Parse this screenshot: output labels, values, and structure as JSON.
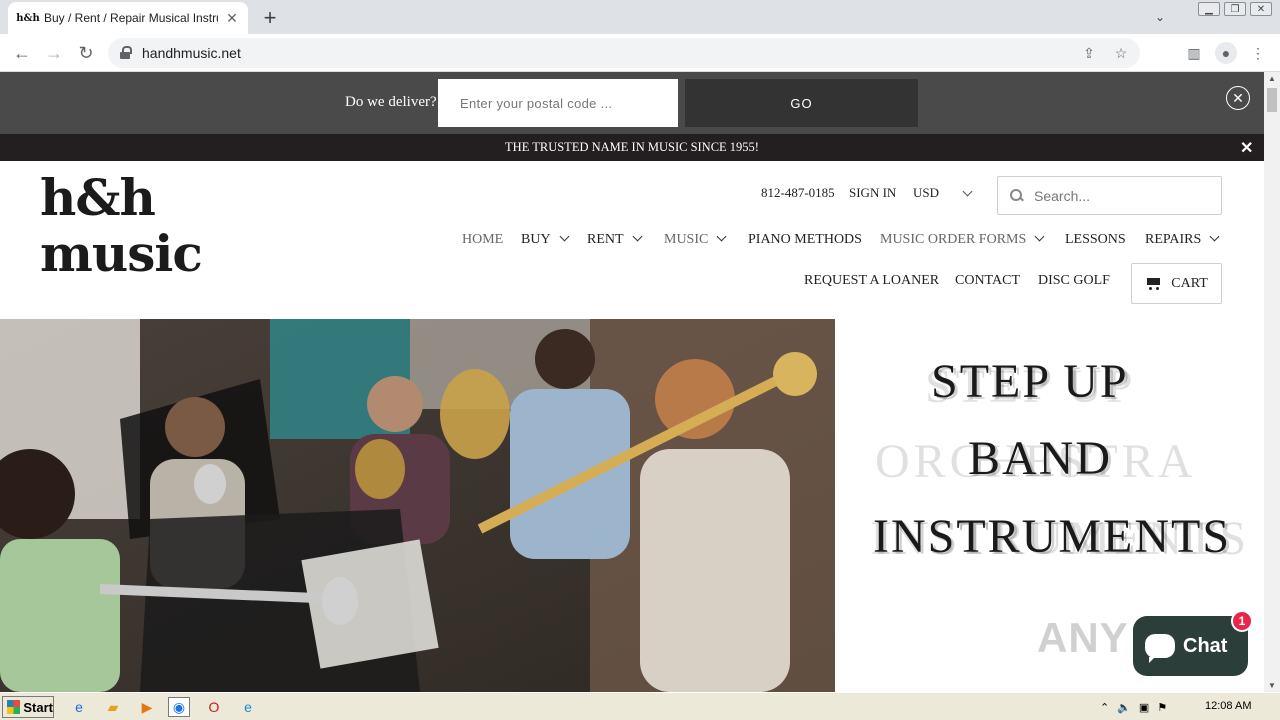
{
  "browser": {
    "tab_title": "Buy / Rent / Repair Musical Instrume",
    "url": "handhmusic.net",
    "favicon_text": "h&h"
  },
  "delivery": {
    "label": "Do we deliver?",
    "postal_placeholder": "Enter your postal code ...",
    "go_label": "GO"
  },
  "announcement": {
    "text": "THE TRUSTED NAME IN MUSIC SINCE 1955!"
  },
  "header": {
    "logo_text": "h&h music",
    "phone": "812-487-0185",
    "sign_in": "SIGN IN",
    "currency": "USD",
    "search_placeholder": "Search..."
  },
  "nav": {
    "items": [
      {
        "label": "HOME"
      },
      {
        "label": "BUY"
      },
      {
        "label": "RENT"
      },
      {
        "label": "MUSIC"
      },
      {
        "label": "PIANO METHODS"
      },
      {
        "label": "MUSIC ORDER FORMS"
      },
      {
        "label": "LESSONS"
      },
      {
        "label": "REPAIRS"
      },
      {
        "label": "REQUEST A LOANER"
      },
      {
        "label": "CONTACT"
      },
      {
        "label": "DISC GOLF"
      }
    ],
    "cart_label": "CART"
  },
  "hero": {
    "line1": "STEP UP",
    "line2": "BAND",
    "line3": "INSTRUMENTS",
    "ghost_line": "ORCHESTRA"
  },
  "chat": {
    "label": "Chat",
    "badge": "1"
  },
  "watermark": "ANY RUN",
  "taskbar": {
    "start_label": "Start",
    "clock": "12:08 AM"
  },
  "colors": {
    "deliver_bar": "#4a4a4a",
    "announce_bar": "#231f20",
    "chat_widget": "#2c3e3a",
    "chat_badge": "#e8264a"
  }
}
